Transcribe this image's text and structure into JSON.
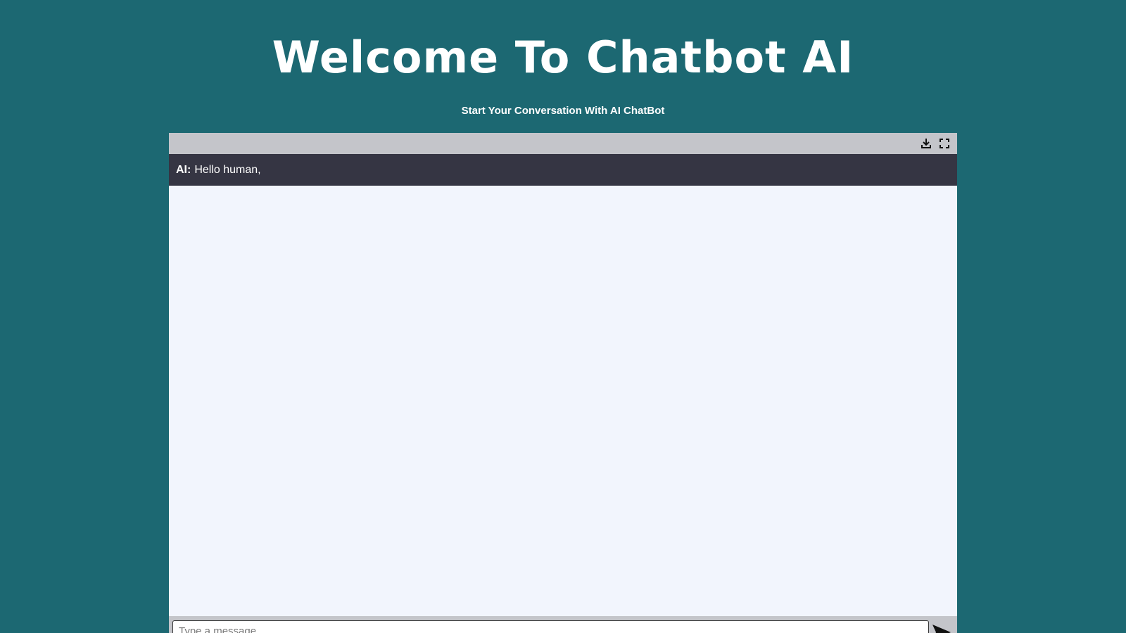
{
  "header": {
    "title": "Welcome To Chatbot AI",
    "subtitle": "Start Your Conversation With AI ChatBot"
  },
  "chat": {
    "toolbar": {
      "icons": [
        "download-icon",
        "fullscreen-icon"
      ]
    },
    "messages": [
      {
        "sender": "AI:",
        "text": "Hello human,"
      }
    ],
    "input": {
      "value": "",
      "placeholder": "Type a message..."
    },
    "send_icon": "send-icon"
  },
  "colors": {
    "page_background": "#1c6872",
    "toolbar_background": "#c4c5ca",
    "message_row_background": "#353543",
    "chat_area_background": "#f2f5fd"
  }
}
